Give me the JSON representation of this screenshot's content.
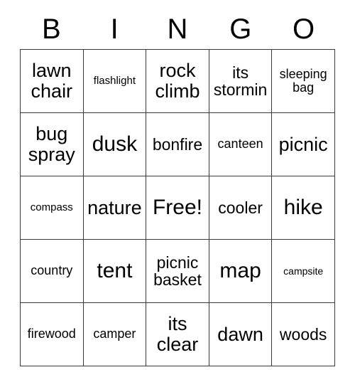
{
  "card": {
    "title": "BINGO",
    "background_color": "#ffffff",
    "border_color": "#3a3a3a",
    "text_color": "#000000"
  },
  "header": {
    "letters": [
      "B",
      "I",
      "N",
      "G",
      "O"
    ]
  },
  "grid": {
    "columns": 5,
    "rows": 5,
    "free_space_label": "Free!",
    "free_space_position": {
      "row": 3,
      "column": 3
    },
    "cells": [
      [
        {
          "text": "lawn\nchair",
          "size": "lg"
        },
        {
          "text": "flashlight",
          "size": "xs"
        },
        {
          "text": "rock\nclimb",
          "size": "lg"
        },
        {
          "text": "its\nstormin",
          "size": "md"
        },
        {
          "text": "sleeping\nbag",
          "size": "sm"
        }
      ],
      [
        {
          "text": "bug\nspray",
          "size": "lg"
        },
        {
          "text": "dusk",
          "size": "xl"
        },
        {
          "text": "bonfire",
          "size": "md"
        },
        {
          "text": "canteen",
          "size": "sm"
        },
        {
          "text": "picnic",
          "size": "lg"
        }
      ],
      [
        {
          "text": "compass",
          "size": "xs"
        },
        {
          "text": "nature",
          "size": "lg"
        },
        {
          "text": "Free!",
          "size": "xl"
        },
        {
          "text": "cooler",
          "size": "md"
        },
        {
          "text": "hike",
          "size": "xl"
        }
      ],
      [
        {
          "text": "country",
          "size": "sm"
        },
        {
          "text": "tent",
          "size": "xl"
        },
        {
          "text": "picnic\nbasket",
          "size": "md"
        },
        {
          "text": "map",
          "size": "xl"
        },
        {
          "text": "campsite",
          "size": "xxs"
        }
      ],
      [
        {
          "text": "firewood",
          "size": "sm"
        },
        {
          "text": "camper",
          "size": "sm"
        },
        {
          "text": "its\nclear",
          "size": "lg"
        },
        {
          "text": "dawn",
          "size": "lg"
        },
        {
          "text": "woods",
          "size": "md"
        }
      ]
    ]
  }
}
